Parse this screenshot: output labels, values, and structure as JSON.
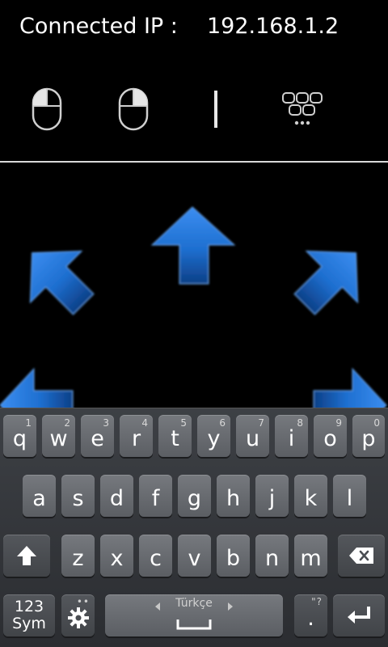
{
  "header": {
    "connected_label": "Connected IP :",
    "ip_value": "192.168.1.2",
    "tools": [
      {
        "icon": "mouse-left-click-icon"
      },
      {
        "icon": "mouse-right-click-icon"
      },
      {
        "icon": "text-cursor-icon"
      },
      {
        "icon": "keypad-icon"
      }
    ]
  },
  "pad": {
    "arrows": [
      "arrow-up-icon",
      "arrow-up-left-icon",
      "arrow-up-right-icon",
      "arrow-left-icon",
      "arrow-right-icon"
    ]
  },
  "keyboard": {
    "row1": [
      {
        "ch": "q",
        "num": "1"
      },
      {
        "ch": "w",
        "num": "2"
      },
      {
        "ch": "e",
        "num": "3"
      },
      {
        "ch": "r",
        "num": "4"
      },
      {
        "ch": "t",
        "num": "5"
      },
      {
        "ch": "y",
        "num": "6"
      },
      {
        "ch": "u",
        "num": "7"
      },
      {
        "ch": "i",
        "num": "8"
      },
      {
        "ch": "o",
        "num": "9"
      },
      {
        "ch": "p",
        "num": "0"
      }
    ],
    "row2": [
      "a",
      "s",
      "d",
      "f",
      "g",
      "h",
      "j",
      "k",
      "l"
    ],
    "row3": [
      "z",
      "x",
      "c",
      "v",
      "b",
      "n",
      "m"
    ],
    "sym_top": "123",
    "sym_bottom": "Sym",
    "language_label": "Türkçe",
    "period": ".",
    "period_hint": "\"?",
    "accent_color": "#1e6fd0"
  }
}
